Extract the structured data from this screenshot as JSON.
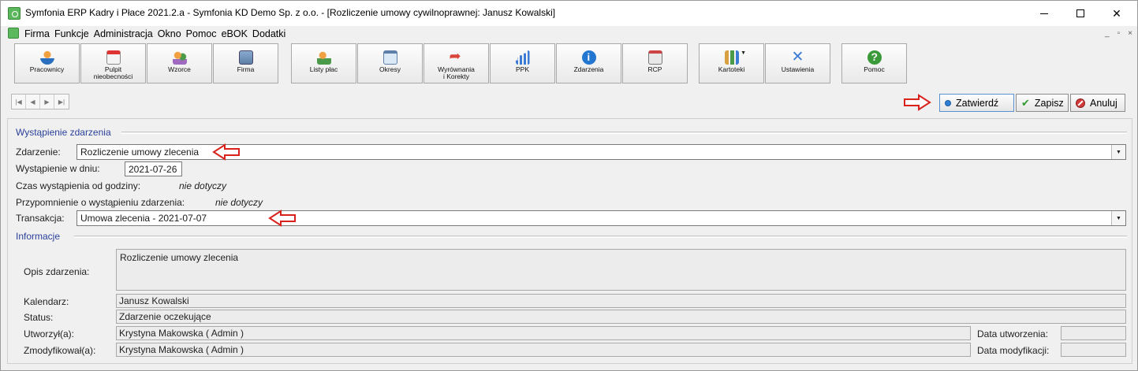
{
  "window": {
    "title": "Symfonia ERP Kadry i Płace 2021.2.a - Symfonia KD Demo Sp. z o.o. - [Rozliczenie umowy cywilnoprawnej:  Janusz Kowalski]",
    "minimize": "–",
    "close": "✕"
  },
  "menu": {
    "items": [
      "Firma",
      "Funkcje",
      "Administracja",
      "Okno",
      "Pomoc",
      "eBOK",
      "Dodatki"
    ],
    "mdi_min": "_",
    "mdi_restore": "▫",
    "mdi_close": "×"
  },
  "toolbar": {
    "buttons": [
      {
        "label": "Pracownicy",
        "icon": "person-icon"
      },
      {
        "label": "Pulpit\nnieobecności",
        "icon": "calendar-icon"
      },
      {
        "label": "Wzorce",
        "icon": "people-icon"
      },
      {
        "label": "Firma",
        "icon": "building-icon"
      },
      {
        "label": "Listy płac",
        "icon": "paylist-icon"
      },
      {
        "label": "Okresy",
        "icon": "window-icon"
      },
      {
        "label": "Wyrównania\ni Korekty",
        "icon": "arrow-icon"
      },
      {
        "label": "PPK",
        "icon": "bars-icon"
      },
      {
        "label": "Zdarzenia",
        "icon": "info-icon"
      },
      {
        "label": "RCP",
        "icon": "rcp-icon"
      },
      {
        "label": "Kartoteki",
        "icon": "folders-icon"
      },
      {
        "label": "Ustawienia",
        "icon": "tools-icon"
      },
      {
        "label": "Pomoc",
        "icon": "help-icon"
      }
    ],
    "kartoteki_caret": "▼"
  },
  "nav": {
    "first": "|◀",
    "prev": "◀",
    "next": "▶",
    "last": "▶|"
  },
  "actions": {
    "confirm": "Zatwierdź",
    "save": "Zapisz",
    "cancel": "Anuluj",
    "save_icon": "✔"
  },
  "section_event": {
    "title": "Wystąpienie zdarzenia",
    "event_label": "Zdarzenie:",
    "event_value": "Rozliczenie umowy zlecenia",
    "date_label": "Wystąpienie w dniu:",
    "date_value": "2021-07-26",
    "time_label": "Czas wystąpienia od godziny:",
    "time_value": "nie dotyczy",
    "reminder_label": "Przypomnienie o wystąpieniu zdarzenia:",
    "reminder_value": "nie dotyczy",
    "transaction_label": "Transakcja:",
    "transaction_value": "Umowa zlecenia  -  2021-07-07",
    "dropdown_caret": "▼"
  },
  "section_info": {
    "title": "Informacje",
    "description_label": "Opis zdarzenia:",
    "description_value": "Rozliczenie umowy zlecenia",
    "calendar_label": "Kalendarz:",
    "calendar_value": "Janusz Kowalski",
    "status_label": "Status:",
    "status_value": "Zdarzenie oczekujące",
    "created_by_label": "Utworzył(a):",
    "created_by_value": "Krystyna Makowska ( Admin )",
    "modified_by_label": "Zmodyfikował(a):",
    "modified_by_value": "Krystyna Makowska ( Admin )",
    "created_date_label": "Data utworzenia:",
    "created_date_value": "",
    "modified_date_label": "Data modyfikacji:",
    "modified_date_value": ""
  },
  "colors": {
    "section_heading": "#2a3f9a",
    "annotation_arrow": "#d9221c",
    "confirm_dot": "#2f7fd6",
    "save_check": "#2f9a2f",
    "cancel_icon": "#d23b3b"
  }
}
